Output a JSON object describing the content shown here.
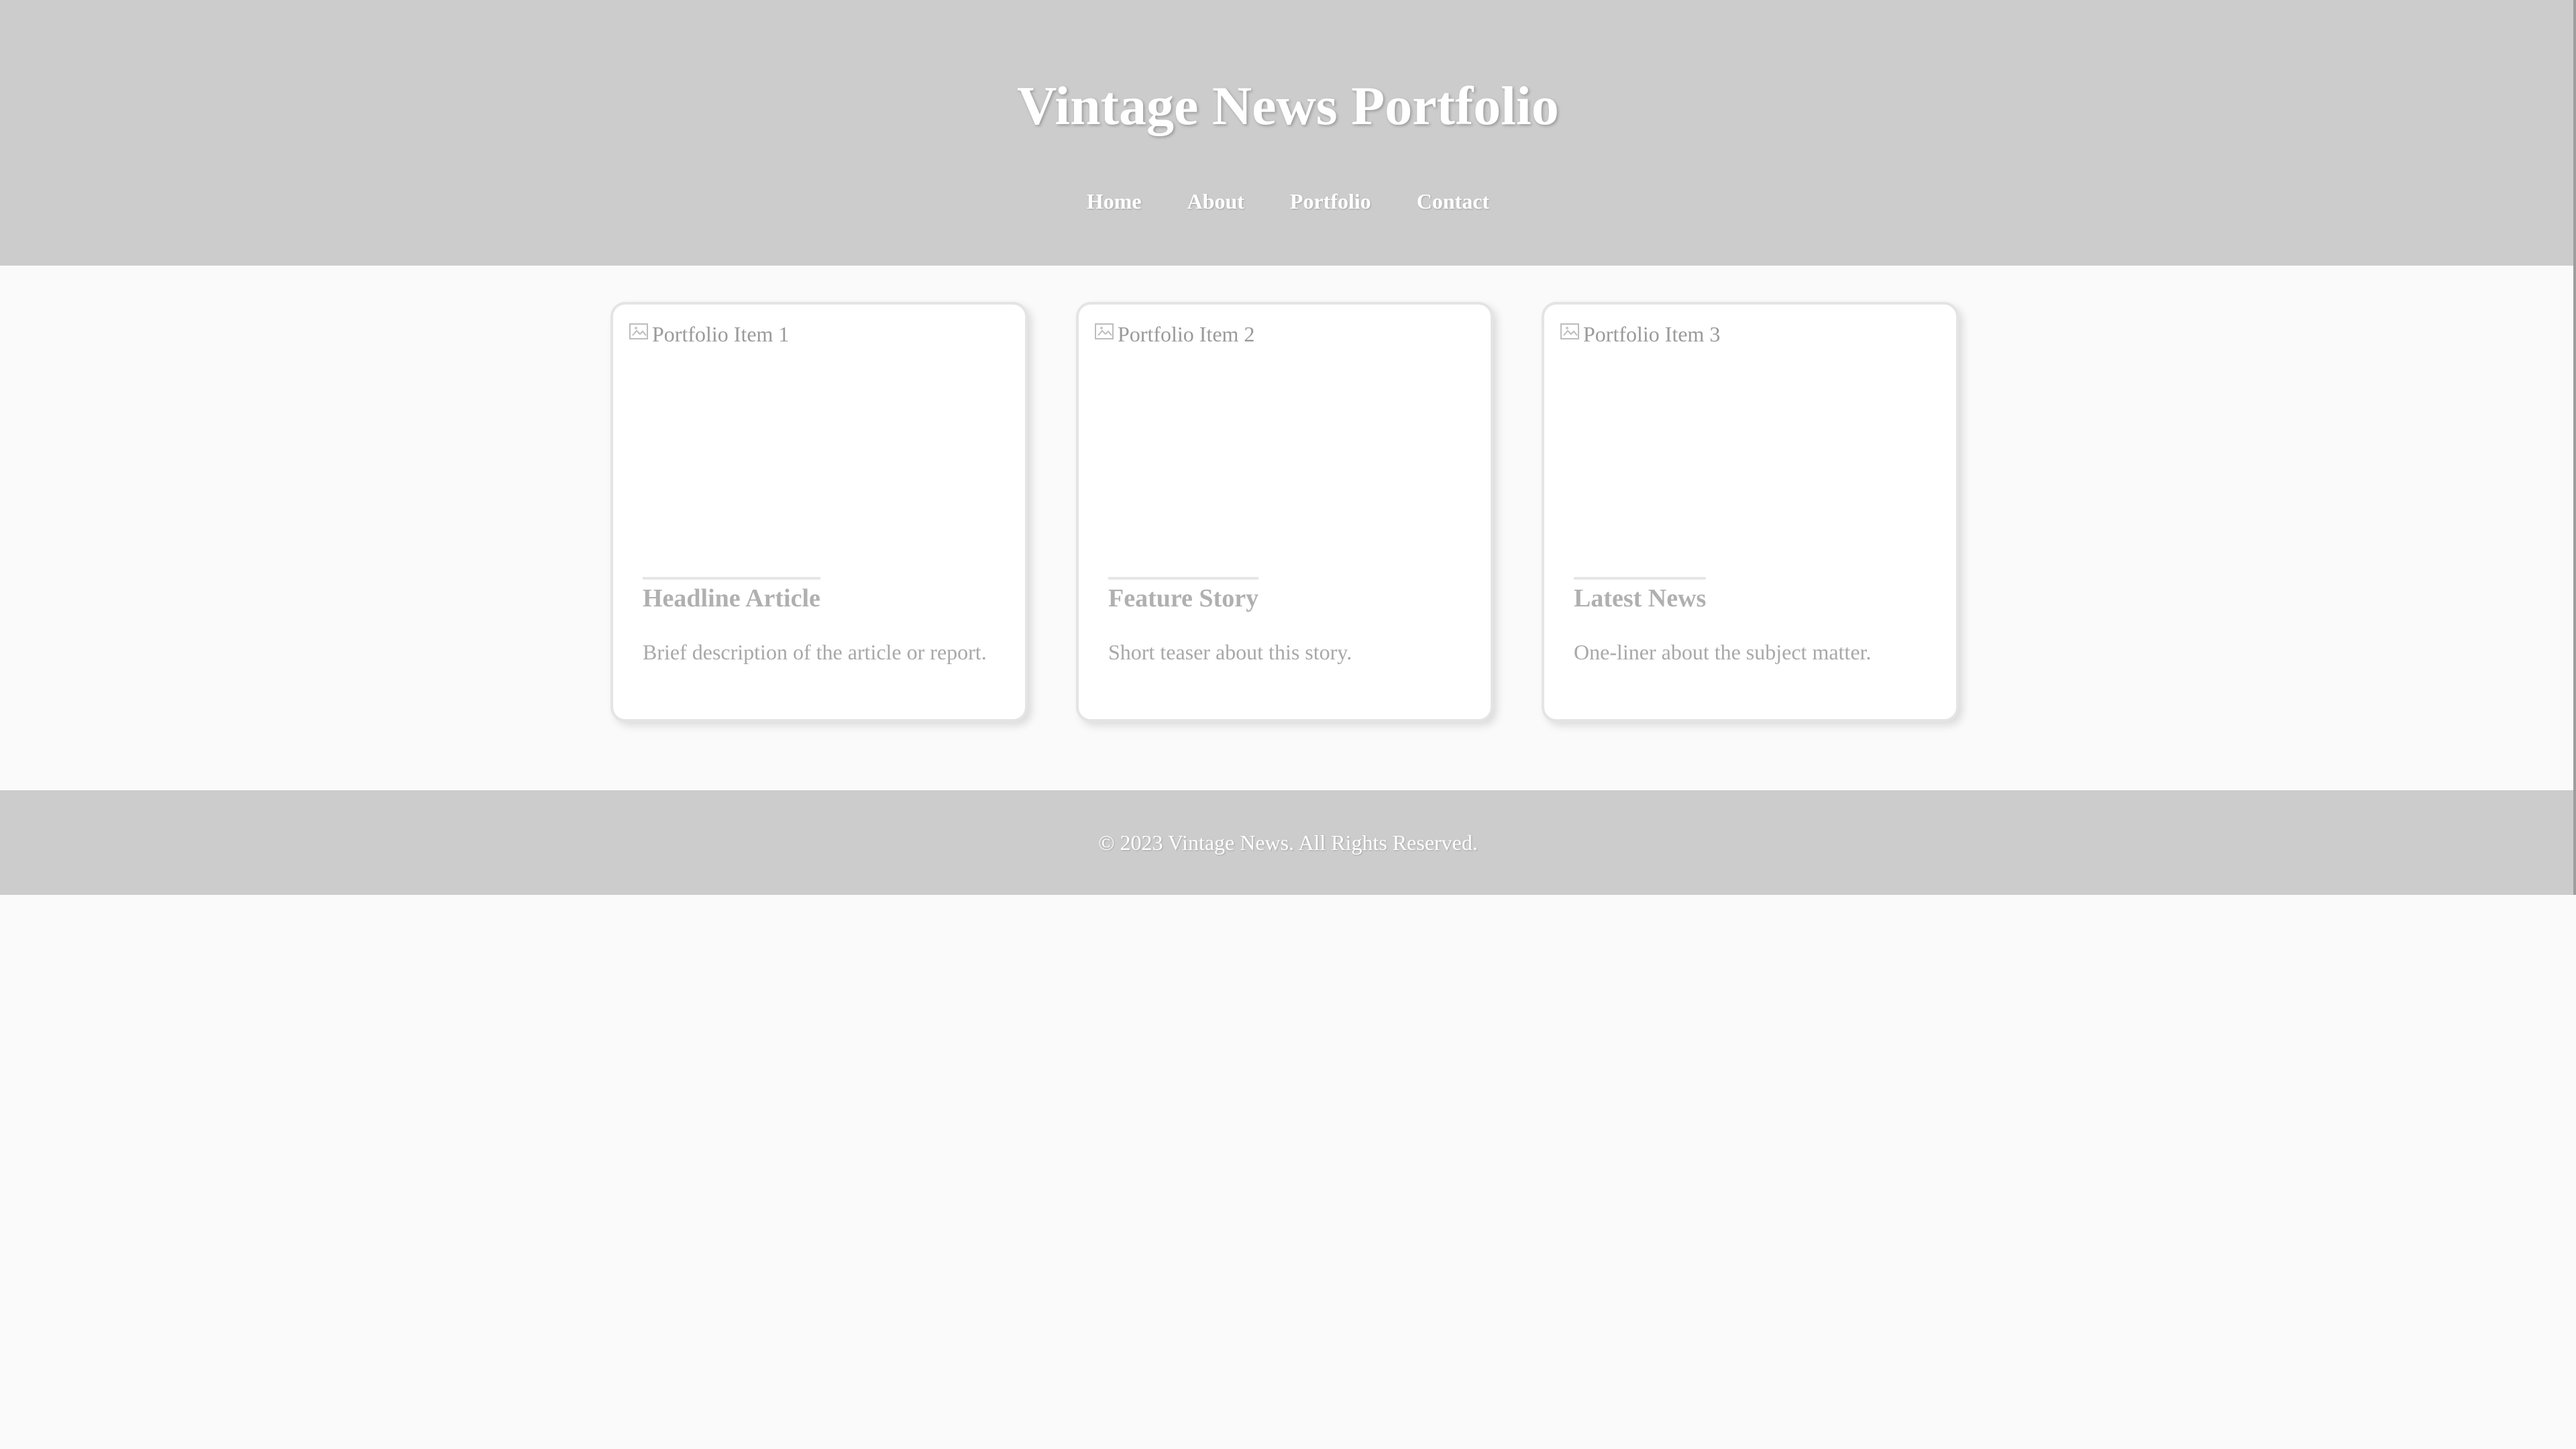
{
  "header": {
    "title": "Vintage News Portfolio",
    "nav": [
      "Home",
      "About",
      "Portfolio",
      "Contact"
    ]
  },
  "portfolio": {
    "items": [
      {
        "image_alt": "Portfolio Item 1",
        "title": "Headline Article",
        "description": "Brief description of the article or report."
      },
      {
        "image_alt": "Portfolio Item 2",
        "title": "Feature Story",
        "description": "Short teaser about this story."
      },
      {
        "image_alt": "Portfolio Item 3",
        "title": "Latest News",
        "description": "One-liner about the subject matter."
      }
    ]
  },
  "footer": {
    "text": "© 2023 Vintage News. All Rights Reserved."
  },
  "colors": {
    "header_bg": "#cccccc",
    "page_bg": "#fafafa",
    "card_bg": "#ffffff",
    "text_light": "#ffffff",
    "text_muted": "#a8a8a8"
  },
  "icons": {
    "broken_image": "broken-image-icon"
  }
}
